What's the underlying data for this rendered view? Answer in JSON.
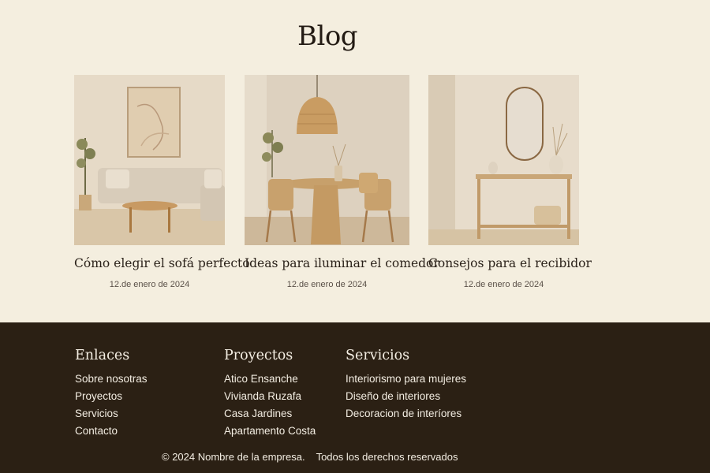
{
  "page": {
    "title": "Blog"
  },
  "posts": [
    {
      "title": "Cómo elegir el sofá perfecto",
      "date": "12.de enero de 2024",
      "image": "living-room-sofa-photo"
    },
    {
      "title": "Ideas para iluminar el comedor",
      "date": "12.de enero de 2024",
      "image": "dining-room-pendant-lamp-photo"
    },
    {
      "title": "Consejos para el recibidor",
      "date": "12.de enero de 2024",
      "image": "entryway-mirror-console-photo"
    }
  ],
  "footer": {
    "links": {
      "heading": "Enlaces",
      "items": [
        "Sobre nosotras",
        "Proyectos",
        "Servicios",
        "Contacto"
      ]
    },
    "projects": {
      "heading": "Proyectos",
      "items": [
        "Atico Ensanche",
        "Vivianda Ruzafa",
        "Casa Jardines",
        "Apartamento Costa"
      ]
    },
    "services": {
      "heading": "Servicios",
      "items": [
        "Interiorismo para mujeres",
        "Diseño de interiores",
        "Decoracion de interíores"
      ]
    },
    "copyright": "© 2024 Nombre de la empresa.",
    "rights": "Todos los derechos reservados"
  },
  "colors": {
    "background": "#f4eedf",
    "footer": "#2b2014",
    "text": "#2a2119"
  }
}
